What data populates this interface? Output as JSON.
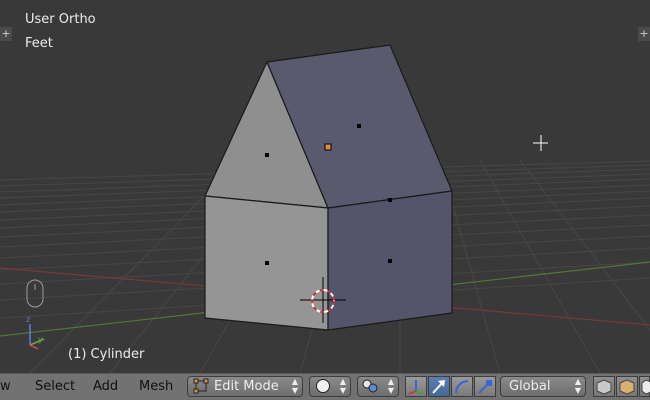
{
  "viewport": {
    "view_name": "User Ortho",
    "units": "Feet",
    "object_label": "(1) Cylinder"
  },
  "header": {
    "menu": [
      {
        "label": "w"
      },
      {
        "label": "Select"
      },
      {
        "label": "Add"
      },
      {
        "label": "Mesh"
      }
    ],
    "mode": "Edit Mode",
    "orientation": "Global"
  },
  "colors": {
    "background": "#393939",
    "face_light": "#8e8e8e",
    "face_dark": "#56566a",
    "active_vertex": "#e38c45",
    "x_axis": "#a33c3c",
    "y_axis": "#5a8a3a",
    "selected_button": "#5a7fb0"
  }
}
